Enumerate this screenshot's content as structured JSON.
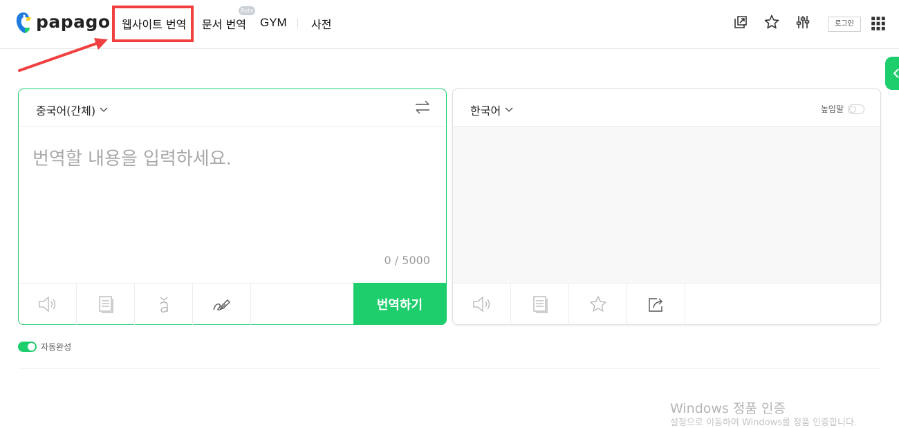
{
  "header": {
    "logo_text": "papago",
    "nav": {
      "website_translation": "웹사이트 번역",
      "document_translation": "문서 번역",
      "document_badge": "Beta",
      "gym": "GYM",
      "dictionary": "사전"
    },
    "icons": [
      "external-link-icon",
      "star-icon",
      "settings-sliders-icon",
      "apps-grid-icon"
    ],
    "login_label": "로그인"
  },
  "source_panel": {
    "language": "중국어(간체)",
    "placeholder": "번역할 내용을 입력하세요.",
    "input_value": "",
    "char_count": "0 / 5000",
    "tools": [
      "speaker-icon",
      "dictionary-icon",
      "pronunciation-icon",
      "handwriting-icon"
    ],
    "translate_label": "번역하기"
  },
  "target_panel": {
    "language": "한국어",
    "honorific_label": "높임말",
    "honorific_enabled": false,
    "tools": [
      "speaker-icon",
      "dictionary-icon",
      "star-icon",
      "share-icon"
    ]
  },
  "autocomplete": {
    "label": "자동완성",
    "enabled": true
  },
  "watermark": {
    "title": "Windows 정품 인증",
    "subtitle": "설정으로 이동하여 Windows를 정품 인증합니다."
  },
  "colors": {
    "accent_green": "#1ece6d",
    "highlight_red": "#f0403f",
    "logo_blue": "#1f7be0",
    "logo_yellow": "#ffd233"
  }
}
